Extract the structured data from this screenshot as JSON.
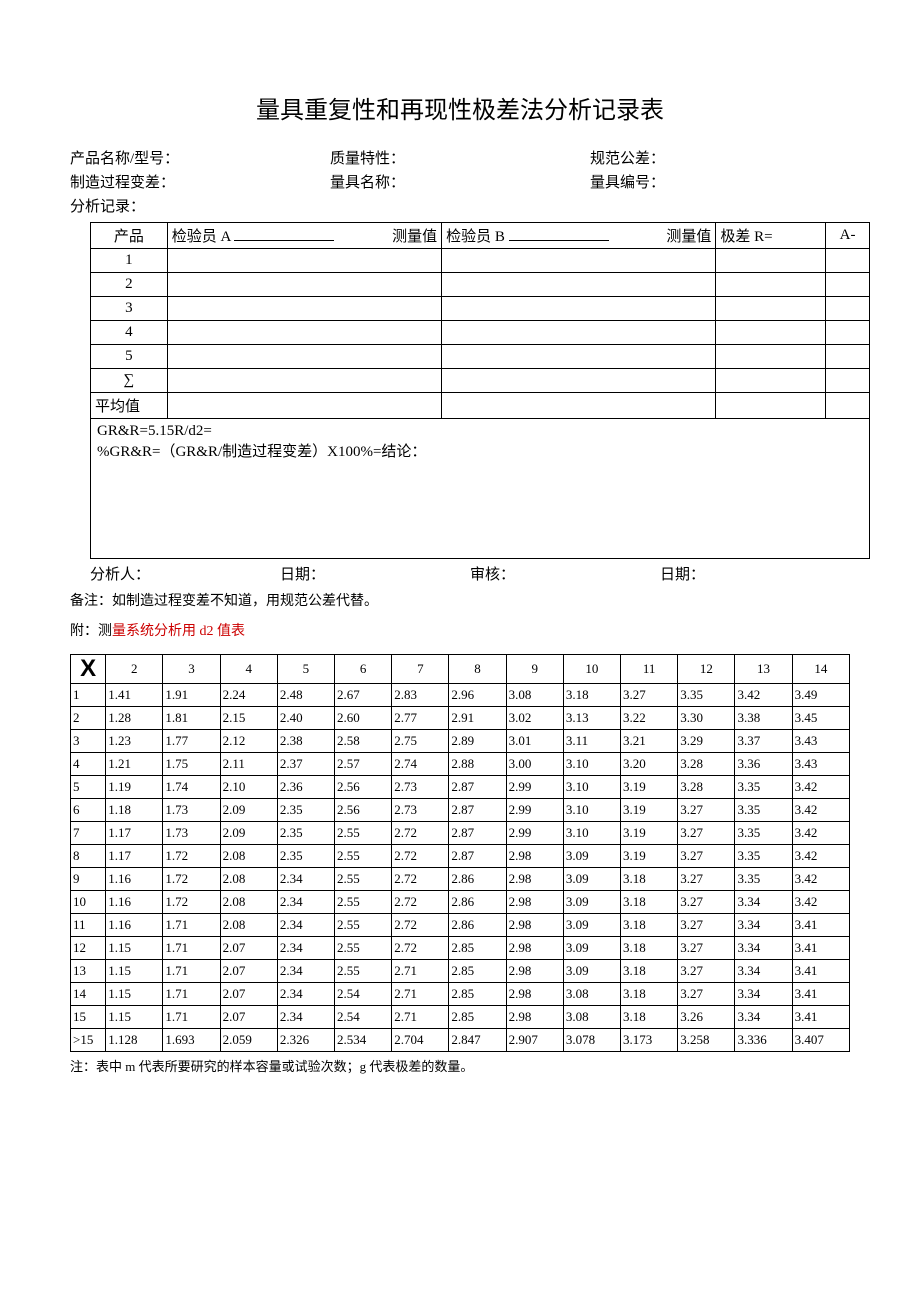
{
  "title": "量具重复性和再现性极差法分析记录表",
  "meta": {
    "row1": [
      {
        "label": "产品名称/型号：",
        "val": ""
      },
      {
        "label": "质量特性：",
        "val": ""
      },
      {
        "label": "规范公差：",
        "val": ""
      }
    ],
    "row2": [
      {
        "label": "制造过程变差：",
        "val": ""
      },
      {
        "label": "量具名称：",
        "val": ""
      },
      {
        "label": "量具编号：",
        "val": ""
      }
    ],
    "single": "分析记录："
  },
  "main": {
    "head": {
      "c0": "产品",
      "c1a": "检验员 A",
      "c1b": "测量值",
      "c2a": "检验员 B",
      "c2b": "测量值",
      "c3": "极差 R=",
      "c4": "A-"
    },
    "rows": [
      "1",
      "2",
      "3",
      "4",
      "5"
    ],
    "sum": "∑",
    "avg": "平均值",
    "formula": {
      "l1": "GR&R=5.15R/d2=",
      "l2": "%GR&R=（GR&R/制造过程变差）X100%=结论："
    }
  },
  "sig": {
    "a": "分析人：",
    "b": "日期：",
    "c": "审核：",
    "d": "日期："
  },
  "note": "备注：如制造过程变差不知道，用规范公差代替。",
  "attach_pre": "附：测",
  "attach_red": "量系统分析用 d2 值表",
  "d2": {
    "cols": [
      "2",
      "3",
      "4",
      "5",
      "6",
      "7",
      "8",
      "9",
      "10",
      "11",
      "12",
      "13",
      "14"
    ],
    "rows": [
      {
        "h": "1",
        "v": [
          "1.41",
          "1.91",
          "2.24",
          "2.48",
          "2.67",
          "2.83",
          "2.96",
          "3.08",
          "3.18",
          "3.27",
          "3.35",
          "3.42",
          "3.49"
        ]
      },
      {
        "h": "2",
        "v": [
          "1.28",
          "1.81",
          "2.15",
          "2.40",
          "2.60",
          "2.77",
          "2.91",
          "3.02",
          "3.13",
          "3.22",
          "3.30",
          "3.38",
          "3.45"
        ]
      },
      {
        "h": "3",
        "v": [
          "1.23",
          "1.77",
          "2.12",
          "2.38",
          "2.58",
          "2.75",
          "2.89",
          "3.01",
          "3.11",
          "3.21",
          "3.29",
          "3.37",
          "3.43"
        ]
      },
      {
        "h": "4",
        "v": [
          "1.21",
          "1.75",
          "2.11",
          "2.37",
          "2.57",
          "2.74",
          "2.88",
          "3.00",
          "3.10",
          "3.20",
          "3.28",
          "3.36",
          "3.43"
        ]
      },
      {
        "h": "5",
        "v": [
          "1.19",
          "1.74",
          "2.10",
          "2.36",
          "2.56",
          "2.73",
          "2.87",
          "2.99",
          "3.10",
          "3.19",
          "3.28",
          "3.35",
          "3.42"
        ]
      },
      {
        "h": "6",
        "v": [
          "1.18",
          "1.73",
          "2.09",
          "2.35",
          "2.56",
          "2.73",
          "2.87",
          "2.99",
          "3.10",
          "3.19",
          "3.27",
          "3.35",
          "3.42"
        ]
      },
      {
        "h": "7",
        "v": [
          "1.17",
          "1.73",
          "2.09",
          "2.35",
          "2.55",
          "2.72",
          "2.87",
          "2.99",
          "3.10",
          "3.19",
          "3.27",
          "3.35",
          "3.42"
        ]
      },
      {
        "h": "8",
        "v": [
          "1.17",
          "1.72",
          "2.08",
          "2.35",
          "2.55",
          "2.72",
          "2.87",
          "2.98",
          "3.09",
          "3.19",
          "3.27",
          "3.35",
          "3.42"
        ]
      },
      {
        "h": "9",
        "v": [
          "1.16",
          "1.72",
          "2.08",
          "2.34",
          "2.55",
          "2.72",
          "2.86",
          "2.98",
          "3.09",
          "3.18",
          "3.27",
          "3.35",
          "3.42"
        ]
      },
      {
        "h": "10",
        "v": [
          "1.16",
          "1.72",
          "2.08",
          "2.34",
          "2.55",
          "2.72",
          "2.86",
          "2.98",
          "3.09",
          "3.18",
          "3.27",
          "3.34",
          "3.42"
        ]
      },
      {
        "h": "11",
        "v": [
          "1.16",
          "1.71",
          "2.08",
          "2.34",
          "2.55",
          "2.72",
          "2.86",
          "2.98",
          "3.09",
          "3.18",
          "3.27",
          "3.34",
          "3.41"
        ]
      },
      {
        "h": "12",
        "v": [
          "1.15",
          "1.71",
          "2.07",
          "2.34",
          "2.55",
          "2.72",
          "2.85",
          "2.98",
          "3.09",
          "3.18",
          "3.27",
          "3.34",
          "3.41"
        ]
      },
      {
        "h": "13",
        "v": [
          "1.15",
          "1.71",
          "2.07",
          "2.34",
          "2.55",
          "2.71",
          "2.85",
          "2.98",
          "3.09",
          "3.18",
          "3.27",
          "3.34",
          "3.41"
        ]
      },
      {
        "h": "14",
        "v": [
          "1.15",
          "1.71",
          "2.07",
          "2.34",
          "2.54",
          "2.71",
          "2.85",
          "2.98",
          "3.08",
          "3.18",
          "3.27",
          "3.34",
          "3.41"
        ]
      },
      {
        "h": "15",
        "v": [
          "1.15",
          "1.71",
          "2.07",
          "2.34",
          "2.54",
          "2.71",
          "2.85",
          "2.98",
          "3.08",
          "3.18",
          "3.26",
          "3.34",
          "3.41"
        ]
      },
      {
        "h": ">15",
        "v": [
          "1.128",
          "1.693",
          "2.059",
          "2.326",
          "2.534",
          "2.704",
          "2.847",
          "2.907",
          "3.078",
          "3.173",
          "3.258",
          "3.336",
          "3.407"
        ]
      }
    ]
  },
  "footnote": "注：表中 m 代表所要研究的样本容量或试验次数；g 代表极差的数量。",
  "x_header": "X"
}
